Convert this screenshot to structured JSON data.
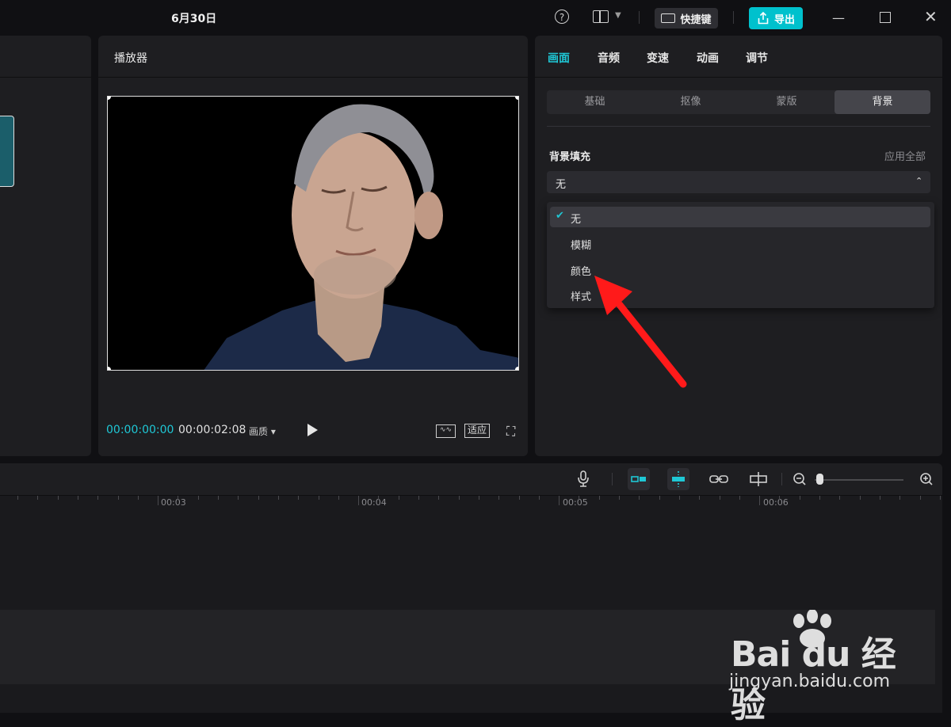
{
  "titlebar": {
    "doc_title": "6月30日",
    "help_icon": "?",
    "shortcut_label": "快捷键",
    "export_label": "导出",
    "minimize_icon": "—",
    "close_icon": "✕",
    "accent_color": "#00c1cd"
  },
  "player": {
    "title": "播放器",
    "timecode_current": "00:00:00:00",
    "timecode_total": "00:00:02:08",
    "quality_label": "画质 ▾",
    "fit_label": "适应",
    "fullscreen_icon": "⛶"
  },
  "props": {
    "tabs": [
      {
        "label": "画面"
      },
      {
        "label": "音频"
      },
      {
        "label": "变速"
      },
      {
        "label": "动画"
      },
      {
        "label": "调节"
      }
    ],
    "subtabs": [
      {
        "label": "基础"
      },
      {
        "label": "抠像"
      },
      {
        "label": "蒙版"
      },
      {
        "label": "背景"
      }
    ],
    "bg_fill_label": "背景填充",
    "apply_all": "应用全部",
    "select_value": "无",
    "select_caret": "⌃",
    "options": [
      {
        "label": "无",
        "selected": true
      },
      {
        "label": "模糊"
      },
      {
        "label": "颜色"
      },
      {
        "label": "样式"
      }
    ],
    "check_icon": "✔"
  },
  "timeline": {
    "ruler": [
      "00:03",
      "00:04",
      "00:05",
      "00:06"
    ]
  },
  "watermark": {
    "brand": "Bai du 经验",
    "sub": "jingyan.baidu.com"
  },
  "annotation_arrow_color": "#ff1a1a"
}
